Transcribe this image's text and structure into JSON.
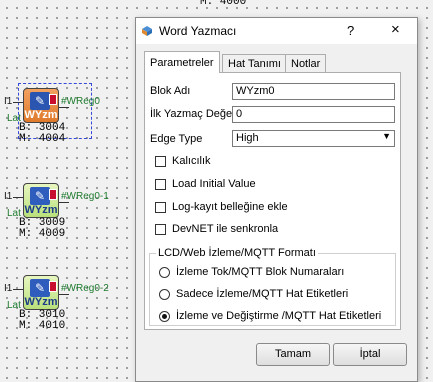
{
  "canvas": {
    "top_label": "M: 4000",
    "blocks": [
      {
        "pin_i1": "I1",
        "pin_lat": "Lat",
        "title": "WYzm",
        "output": "#WReg0",
        "b_line": "B: 3004",
        "m_line": "M: 4004",
        "selected": true,
        "color": "#e88a3e"
      },
      {
        "pin_i1": "I1",
        "pin_lat": "Lat",
        "title": "WYzm",
        "output": "#WReg0-1",
        "b_line": "B: 3009",
        "m_line": "M: 4009",
        "selected": false,
        "color": "#c7e89a"
      },
      {
        "pin_i1": "I1",
        "pin_lat": "Lat",
        "title": "WYzm",
        "output": "#WReg0-2",
        "b_line": "B: 3010",
        "m_line": "M: 4010",
        "selected": false,
        "color": "#c7e89a"
      }
    ]
  },
  "dialog": {
    "title": "Word Yazmacı",
    "help": "?",
    "close": "×",
    "icon": "app-icon",
    "tabs": [
      {
        "label": "Parametreler",
        "active": true
      },
      {
        "label": "Hat Tanımı",
        "active": false
      },
      {
        "label": "Notlar",
        "active": false
      }
    ],
    "fields": {
      "blok_adi_label": "Blok Adı",
      "blok_adi_value": "WYzm0",
      "ilk_label": "İlk Yazmaç Değeri",
      "ilk_value": "0",
      "edge_label": "Edge Type",
      "edge_value": "High"
    },
    "checkboxes": [
      {
        "label": "Kalıcılık",
        "checked": false
      },
      {
        "label": "Load Initial Value",
        "checked": false
      },
      {
        "label": "Log-kayıt belleğine ekle",
        "checked": false
      },
      {
        "label": "DevNET ile senkronla",
        "checked": false
      }
    ],
    "group": {
      "legend": "LCD/Web İzleme/MQTT Formatı",
      "options": [
        {
          "label": "İzleme Tok/MQTT Blok Numaraları",
          "selected": false
        },
        {
          "label": "Sadece İzleme/MQTT Hat Etiketleri",
          "selected": false
        },
        {
          "label": "İzleme ve Değiştirme /MQTT Hat Etiketleri",
          "selected": true
        }
      ]
    },
    "buttons": {
      "ok": "Tamam",
      "cancel": "İptal"
    }
  }
}
